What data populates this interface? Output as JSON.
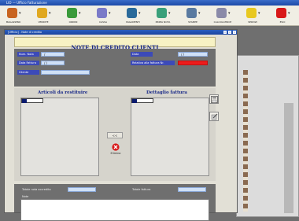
{
  "window": {
    "title": "LIO — Ufficio Fatturazione"
  },
  "toolbar": {
    "items": [
      {
        "label": "MAGAZZINO",
        "icon": "warehouse-icon",
        "color": "#c86420"
      },
      {
        "label": "VENDITE",
        "icon": "sales-icon",
        "color": "#e0a820"
      },
      {
        "label": "ORDINI",
        "icon": "orders-icon",
        "color": "#3a9a3a"
      },
      {
        "label": "CASSA",
        "icon": "cash-icon",
        "color": "#7a7ac8"
      },
      {
        "label": "PAGAMENTI",
        "icon": "payments-icon",
        "color": "#2a6a9a"
      },
      {
        "label": "PRIMA NOTA",
        "icon": "ledger-icon",
        "color": "#3aa07a"
      },
      {
        "label": "STAMPE",
        "icon": "print-icon",
        "color": "#5a7aa0"
      },
      {
        "label": "CALCOLATRICE",
        "icon": "calculator-icon",
        "color": "#8a8aa8"
      },
      {
        "label": "SERVIZI",
        "icon": "services-icon",
        "color": "#e8c820"
      },
      {
        "label": "ESCI",
        "icon": "exit-icon",
        "color": "#d81818"
      }
    ]
  },
  "child_window": {
    "title": "[Ufficio] - Note di credito"
  },
  "form": {
    "title": "NOTE DI CREDITO CLIENTI",
    "fields": {
      "num_nota_label": "Num. Nota",
      "num_nota_value": "/",
      "data_fattura_label": "Data Fattura",
      "data_fattura_value": "/ /",
      "cliente_label": "Cliente",
      "cliente_value": "",
      "data_label": "Data",
      "data_value": "/ /",
      "relativa_label": "Relativa alla fattura Nr.",
      "relativa_value": ""
    },
    "articoli_title": "Articoli da restituire",
    "dettaglio_title": "Dettaglio fattura",
    "transfer_button": "<<",
    "delete_button": "Elimina",
    "totale_nota_label": "Totale nota accredito",
    "totale_nota_value": "",
    "totale_fattura_label": "Totale fattura",
    "totale_fattura_value": "",
    "note_label": "Note",
    "note_value": ""
  },
  "colors": {
    "header_bg": "#f7f2c4",
    "label_bg": "#3c4ab8",
    "field_bg": "#cfe0f6",
    "alert_field": "#ec1c1c",
    "title_text": "#1a2a88"
  }
}
